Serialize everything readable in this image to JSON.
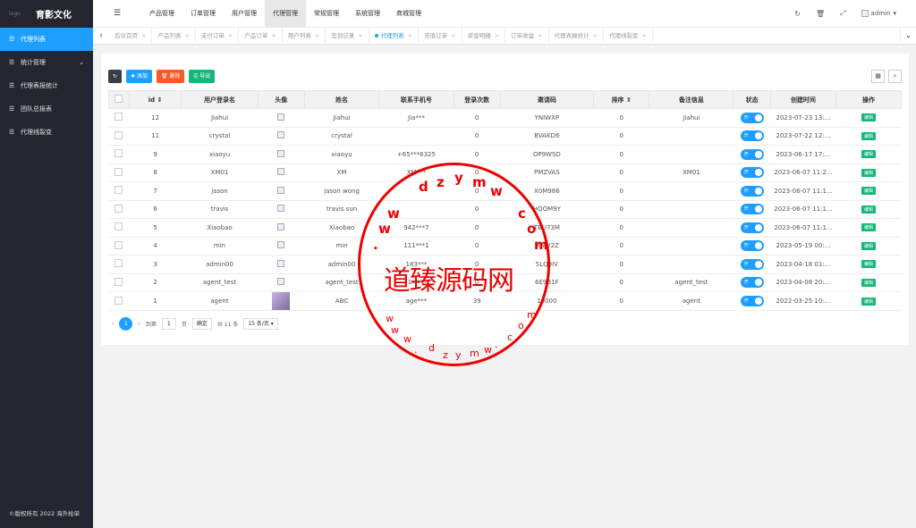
{
  "brand": {
    "logo_alt": "logo",
    "name": "育影文化"
  },
  "sidebar": {
    "items": [
      {
        "label": "代理列表",
        "icon": "list-icon",
        "active": true
      },
      {
        "label": "统计管理",
        "icon": "list-icon",
        "has_arrow": true
      },
      {
        "label": "代理表报统计",
        "icon": "list-icon"
      },
      {
        "label": "团队总报表",
        "icon": "list-icon"
      },
      {
        "label": "代理线裂变",
        "icon": "list-icon"
      }
    ],
    "copyright": "©版权所有 2022 海外抢单"
  },
  "topnav": {
    "items": [
      "产品管理",
      "订单管理",
      "用户管理",
      "代理管理",
      "常规管理",
      "系统管理",
      "商城管理"
    ],
    "active": "代理管理",
    "user": "admin"
  },
  "tabs": [
    {
      "label": "后台首页"
    },
    {
      "label": "产品列表"
    },
    {
      "label": "支付订单"
    },
    {
      "label": "产品订单"
    },
    {
      "label": "用户列表"
    },
    {
      "label": "签到记录"
    },
    {
      "label": "代理列表",
      "active": true
    },
    {
      "label": "充值订单"
    },
    {
      "label": "资金明细"
    },
    {
      "label": "订单收益"
    },
    {
      "label": "代理表报统计"
    },
    {
      "label": "代理线裂变"
    }
  ],
  "toolbar": {
    "add": "✚ 添加",
    "delete": "🗑 删除",
    "export": "🖺 导出"
  },
  "table": {
    "headers": [
      "id",
      "用户登录名",
      "头像",
      "姓名",
      "联系手机号",
      "登录次数",
      "邀请码",
      "排序",
      "备注信息",
      "状态",
      "创建时间",
      "操作"
    ],
    "rows": [
      [
        "12",
        "Jiahui",
        "",
        "Jiahui",
        "Jia***",
        "0",
        "YNIWXP",
        "0",
        "Jiahui",
        "开",
        "2023-07-23 13:...",
        "编辑"
      ],
      [
        "11",
        "crystal",
        "",
        "crystal",
        "",
        "0",
        "BVAKD6",
        "0",
        "",
        "开",
        "2023-07-22 12:...",
        "编辑"
      ],
      [
        "9",
        "xiaoyu",
        "",
        "xiaoyu",
        "+65***6325",
        "0",
        "OP9WSD",
        "0",
        "",
        "开",
        "2023-06-17 17:...",
        "编辑"
      ],
      [
        "8",
        "XM01",
        "",
        "XM",
        "XM***",
        "0",
        "PMZVAS",
        "0",
        "XM01",
        "开",
        "2023-06-07 11:2...",
        "编辑"
      ],
      [
        "7",
        "jason",
        "",
        "jason wong",
        "",
        "0",
        "X0M986",
        "0",
        "",
        "开",
        "2023-06-07 11:1...",
        "编辑"
      ],
      [
        "6",
        "travis",
        "",
        "travis sun",
        "",
        "0",
        "HQOM9Y",
        "0",
        "",
        "开",
        "2023-06-07 11:1...",
        "编辑"
      ],
      [
        "5",
        "Xiaobao",
        "",
        "Xiaobao",
        "942***7",
        "0",
        "TBU73M",
        "0",
        "",
        "开",
        "2023-06-07 11:1...",
        "编辑"
      ],
      [
        "4",
        "min",
        "",
        "min",
        "111***1",
        "0",
        "HFAV2Z",
        "0",
        "",
        "开",
        "2023-05-19 00:...",
        "编辑"
      ],
      [
        "3",
        "admin00",
        "",
        "admin00",
        "183***",
        "0",
        "5LQ9IV",
        "0",
        "",
        "开",
        "2023-04-18 01:...",
        "编辑"
      ],
      [
        "2",
        "agent_test",
        "",
        "agent_test",
        "1***1",
        "0",
        "6E9B1F",
        "0",
        "agent_test",
        "开",
        "2023-04-08 20:...",
        "编辑"
      ],
      [
        "1",
        "agent",
        "",
        "ABC",
        "age***",
        "39",
        "10000",
        "0",
        "agent",
        "开",
        "2022-03-25 10:...",
        "编辑"
      ]
    ]
  },
  "pagination": {
    "page": "1",
    "goto_label": "到第",
    "page_input": "1",
    "page_unit": "页",
    "confirm": "确定",
    "total": "共 11 条",
    "per_page": "15 条/页"
  },
  "watermark": {
    "text": "道臻源码网",
    "letters_top": [
      "d",
      "z",
      "y",
      "m",
      "w",
      "w",
      "w",
      "."
    ],
    "letters_bottom": [
      "w",
      "w",
      "w",
      ".",
      "d",
      "z",
      "y",
      "m",
      "w",
      ".",
      "c",
      "o",
      "m"
    ]
  }
}
